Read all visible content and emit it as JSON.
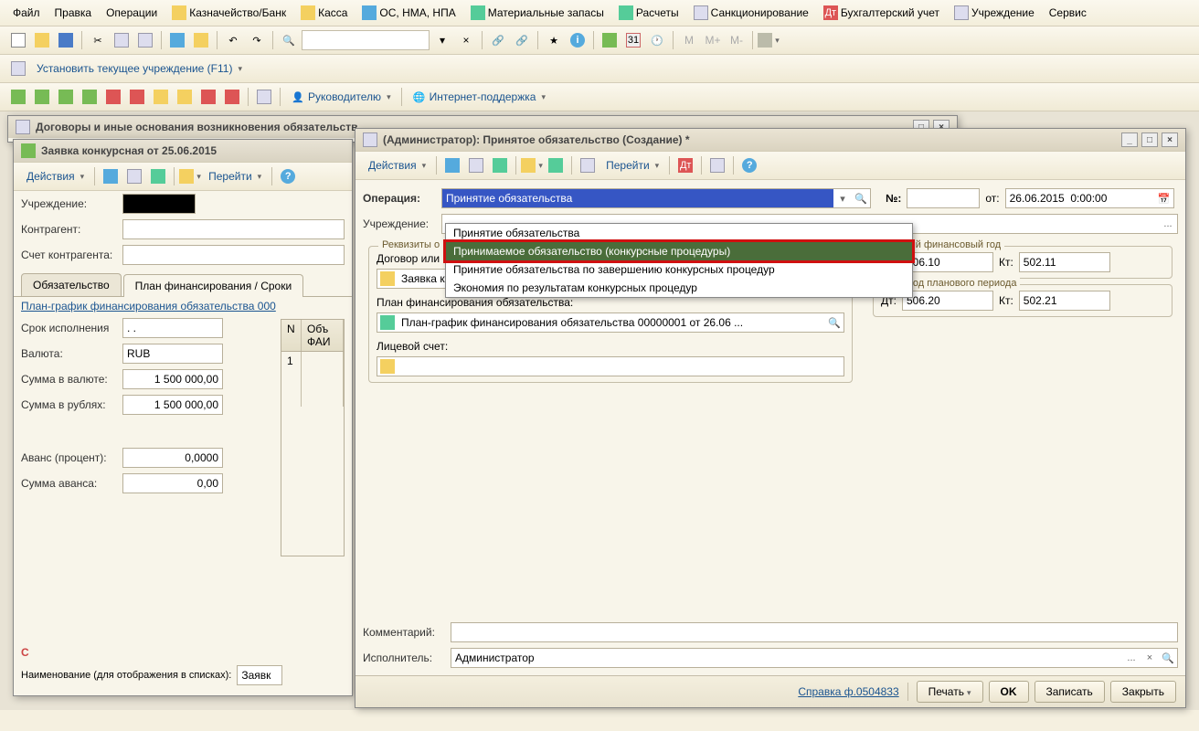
{
  "menubar": {
    "file": "Файл",
    "edit": "Правка",
    "operations": "Операции",
    "treasury": "Казначейство/Банк",
    "cash": "Касса",
    "assets": "ОС, НМА, НПА",
    "inventory": "Материальные запасы",
    "calculations": "Расчеты",
    "sanctioning": "Санкционирование",
    "accounting": "Бухгалтерский учет",
    "institution": "Учреждение",
    "service": "Сервис"
  },
  "toolbar2": {
    "set_institution": "Установить текущее учреждение (F11)"
  },
  "toolbar3": {
    "manager": "Руководителю",
    "support": "Интернет-поддержка"
  },
  "bg_window": {
    "title": "Договоры и иные основания возникновения обязательств"
  },
  "left_window": {
    "title": "Заявка конкурсная  от 25.06.2015",
    "actions": "Действия",
    "goto": "Перейти",
    "fields": {
      "org_label": "Учреждение:",
      "contragent_label": "Контрагент:",
      "contragent_account_label": "Счет контрагента:"
    },
    "tabs": {
      "obligation": "Обязательство",
      "finplan": "План финансирования / Сроки"
    },
    "plan_link": "План-график финансирования обязательства 000",
    "rows": {
      "deadline_label": "Срок исполнения",
      "deadline_value": ". .",
      "currency_label": "Валюта:",
      "currency_value": "RUB",
      "sum_currency_label": "Сумма в валюте:",
      "sum_currency_value": "1 500 000,00",
      "sum_rub_label": "Сумма в рублях:",
      "sum_rub_value": "1 500 000,00",
      "advance_pct_label": "Аванс (процент):",
      "advance_pct_value": "0,0000",
      "advance_sum_label": "Сумма аванса:",
      "advance_sum_value": "0,00"
    },
    "grid": {
      "col_n": "N",
      "col_obj": "Объ",
      "col_fai": "ФАИ",
      "row1": "1"
    },
    "bottom": {
      "name_label": "Наименование (для отображения в списках):",
      "name_value": "Заявк"
    }
  },
  "main_window": {
    "title": "(Администратор): Принятое обязательство (Создание) *",
    "actions": "Действия",
    "goto": "Перейти",
    "operation_label": "Операция:",
    "operation_value": "Принятие обязательства",
    "num_label": "№:",
    "from_label": "от:",
    "from_value": "26.06.2015  0:00:00",
    "org_label": "Учреждение:",
    "sections": {
      "requisites": "Реквизиты о",
      "contract_label": "Договор или",
      "contract_value": "Заявка конкурсная  от 25.06.2015",
      "finplan_label": "План финансирования обязательства:",
      "finplan_value": "План-график финансирования обязательства 00000001 от 26.06 ...",
      "account_label": "Лицевой счет:"
    },
    "dropdown": {
      "item1": "Принятие обязательства",
      "item2": "Принимаемое обязательство (конкурсные процедуры)",
      "item3": "Принятие обязательства по завершению конкурсных процедур",
      "item4": "Экономия по результатам конкурсных процедур"
    },
    "groups": {
      "current_year": "екущий финансовый год",
      "year1": "1 - й год планового периода",
      "dt_label": "Дт:",
      "kt_label": "Кт:",
      "dt1": "506.10",
      "kt1": "502.11",
      "dt2": "506.20",
      "kt2": "502.21"
    },
    "comment_label": "Комментарий:",
    "executor_label": "Исполнитель:",
    "executor_value": "Администратор",
    "footer": {
      "help": "Справка ф.0504833",
      "print": "Печать",
      "ok": "OK",
      "save": "Записать",
      "close": "Закрыть"
    }
  }
}
